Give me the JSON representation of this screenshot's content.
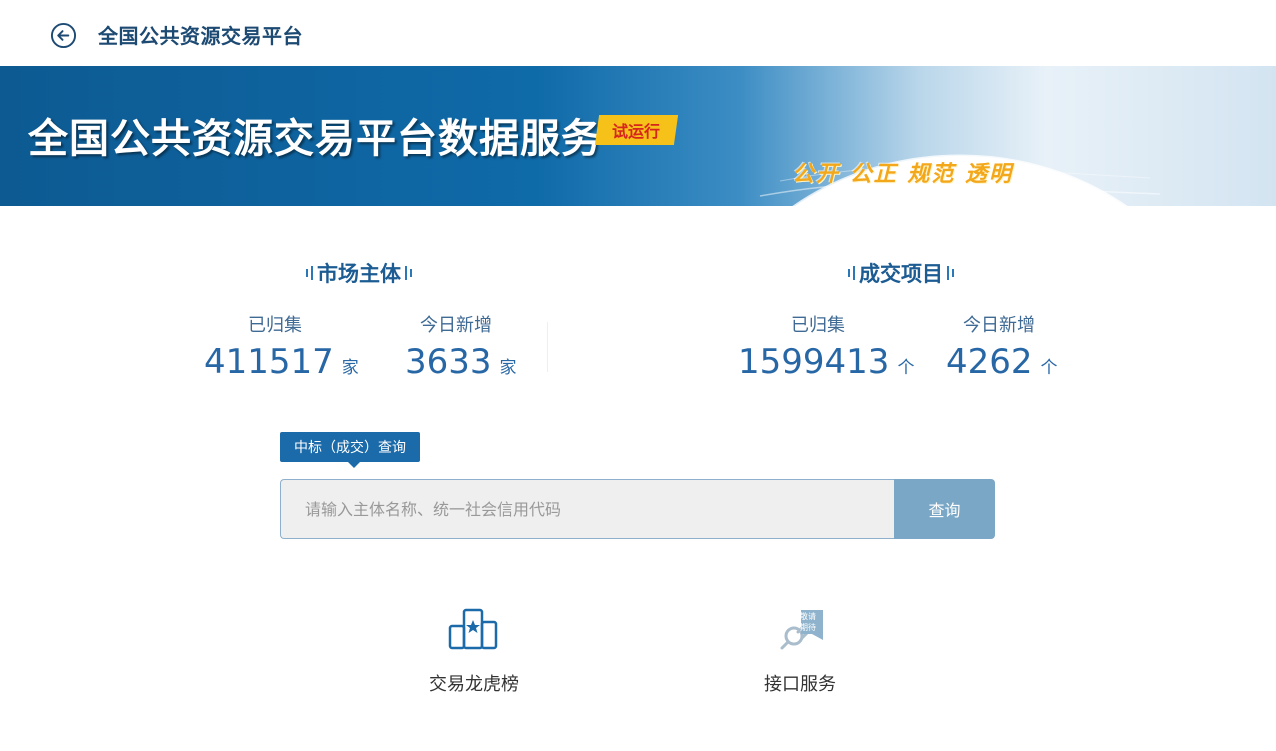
{
  "header": {
    "title": "全国公共资源交易平台",
    "back_icon": "back-arrow-circle-icon"
  },
  "banner": {
    "title": "全国公共资源交易平台数据服务",
    "badge": "试运行",
    "slogan": "公开 公正 规范 透明"
  },
  "stats": {
    "market": {
      "title": "市场主体",
      "collected_label": "已归集",
      "collected_value": "411517",
      "collected_unit": "家",
      "today_label": "今日新增",
      "today_value": "3633",
      "today_unit": "家"
    },
    "deals": {
      "title": "成交项目",
      "collected_label": "已归集",
      "collected_value": "1599413",
      "collected_unit": "个",
      "today_label": "今日新增",
      "today_value": "4262",
      "today_unit": "个"
    }
  },
  "search": {
    "tab_label": "中标（成交）查询",
    "placeholder": "请输入主体名称、统一社会信用代码",
    "value": "",
    "button_label": "查询"
  },
  "features": [
    {
      "label": "交易龙虎榜",
      "icon": "podium-star-icon"
    },
    {
      "label": "接口服务",
      "icon": "plug-coming-soon-icon",
      "badge": "敬请期待"
    }
  ],
  "colors": {
    "primary": "#1b6aa9",
    "title_text": "#1d4a72",
    "stat_value": "#2867a6",
    "search_button": "#7aa7c6",
    "badge_bg": "#f6c21a",
    "badge_text": "#d6251c",
    "slogan": "#f3a71b"
  }
}
